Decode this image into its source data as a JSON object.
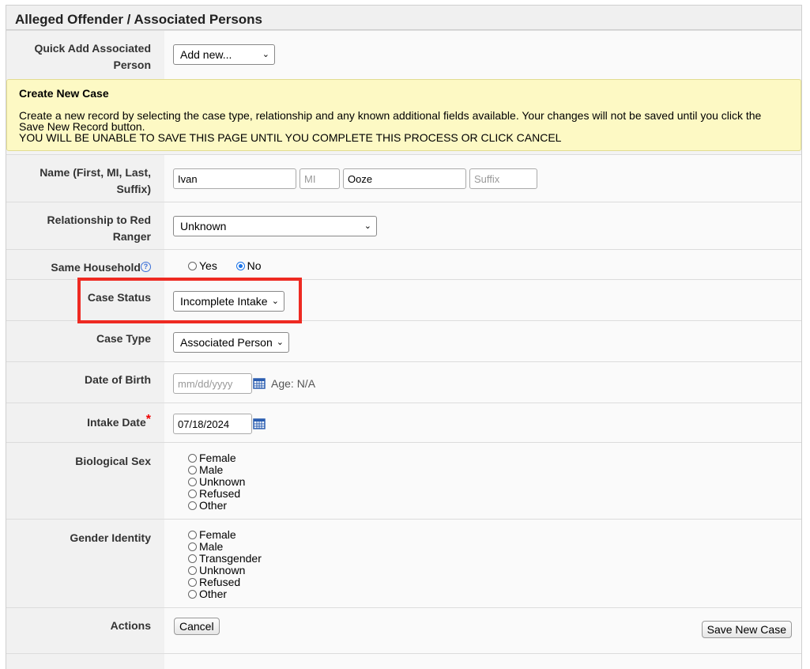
{
  "header": {
    "title": "Alleged Offender / Associated Persons"
  },
  "quick_add": {
    "label": "Quick Add Associated Person",
    "selected": "Add new..."
  },
  "notice": {
    "title": "Create New Case",
    "body": "Create a new record by selecting the case type, relationship and any known additional fields available. Your changes will not be saved until you click the Save New Record button.",
    "warning": "YOU WILL BE UNABLE TO SAVE THIS PAGE UNTIL YOU COMPLETE THIS PROCESS OR CLICK CANCEL"
  },
  "name": {
    "label": "Name (First, MI, Last, Suffix)",
    "first": "Ivan",
    "mi_placeholder": "MI",
    "last": "Ooze",
    "suffix_placeholder": "Suffix"
  },
  "relationship": {
    "label": "Relationship to Red Ranger",
    "selected": "Unknown"
  },
  "household": {
    "label": "Same Household",
    "help": "?",
    "options": [
      "Yes",
      "No"
    ],
    "selected": "No"
  },
  "case_status": {
    "label": "Case Status",
    "selected": "Incomplete Intake"
  },
  "case_type": {
    "label": "Case Type",
    "selected": "Associated Person"
  },
  "dob": {
    "label": "Date of Birth",
    "placeholder": "mm/dd/yyyy",
    "age": "Age: N/A"
  },
  "intake_date": {
    "label": "Intake Date",
    "required_mark": "*",
    "value": "07/18/2024"
  },
  "biological_sex": {
    "label": "Biological Sex",
    "options": [
      "Female",
      "Male",
      "Unknown",
      "Refused",
      "Other"
    ]
  },
  "gender_identity": {
    "label": "Gender Identity",
    "options": [
      "Female",
      "Male",
      "Transgender",
      "Unknown",
      "Refused",
      "Other"
    ]
  },
  "actions": {
    "label": "Actions",
    "cancel": "Cancel",
    "save": "Save New Case"
  },
  "colors": {
    "highlight": "#ee2a22",
    "notice_bg": "#fdf9c4",
    "accent": "#1a73e8"
  },
  "icons": {
    "dropdown": "chevron-down-icon",
    "calendar": "calendar-icon",
    "help": "help-icon"
  }
}
